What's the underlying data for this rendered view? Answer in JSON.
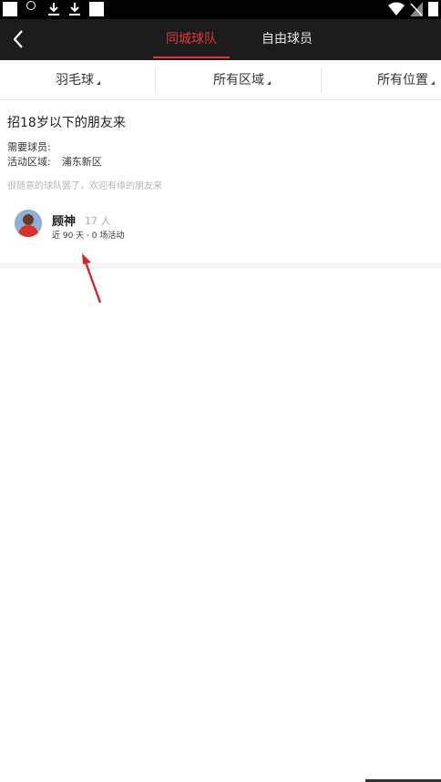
{
  "header": {
    "tabs": [
      {
        "label": "同城球队",
        "active": true
      },
      {
        "label": "自由球员",
        "active": false
      }
    ]
  },
  "filters": {
    "sport": "羽毛球",
    "area": "所有区域",
    "position": "所有位置"
  },
  "team": {
    "title": "招18岁以下的朋友来",
    "needed_label": "需要球员:",
    "needed_value": "",
    "area_label": "活动区域:",
    "area_value": "浦东新区",
    "description": "很随意的球队罢了，欢迎有缘的朋友来",
    "captain_name": "顾神",
    "member_count": "17 人",
    "activity": "近 90 天 · 0 场活动"
  },
  "colors": {
    "accent": "#e5363b",
    "header_bg": "#1c1c1c",
    "status_bar_bg": "#000000"
  }
}
